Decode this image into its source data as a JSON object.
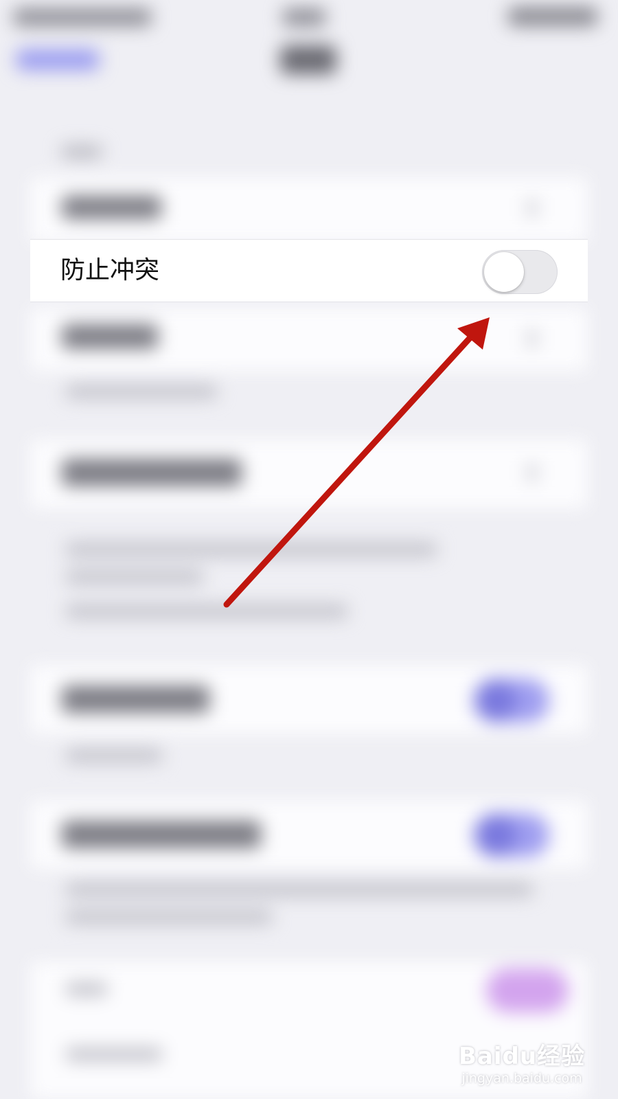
{
  "settings_row": {
    "label": "防止冲突",
    "toggle_state": "off"
  },
  "annotation": {
    "arrow_color": "#c0160e",
    "points_to": "toggle-switch"
  },
  "watermark": {
    "logo_text": "Baidu经验",
    "url_text": "jingyan.baidu.com"
  },
  "colors": {
    "background": "#efeff4",
    "row_background": "#ffffff",
    "toggle_off_track": "#e9e9ec",
    "toggle_on_track": "#9f9ef0"
  }
}
